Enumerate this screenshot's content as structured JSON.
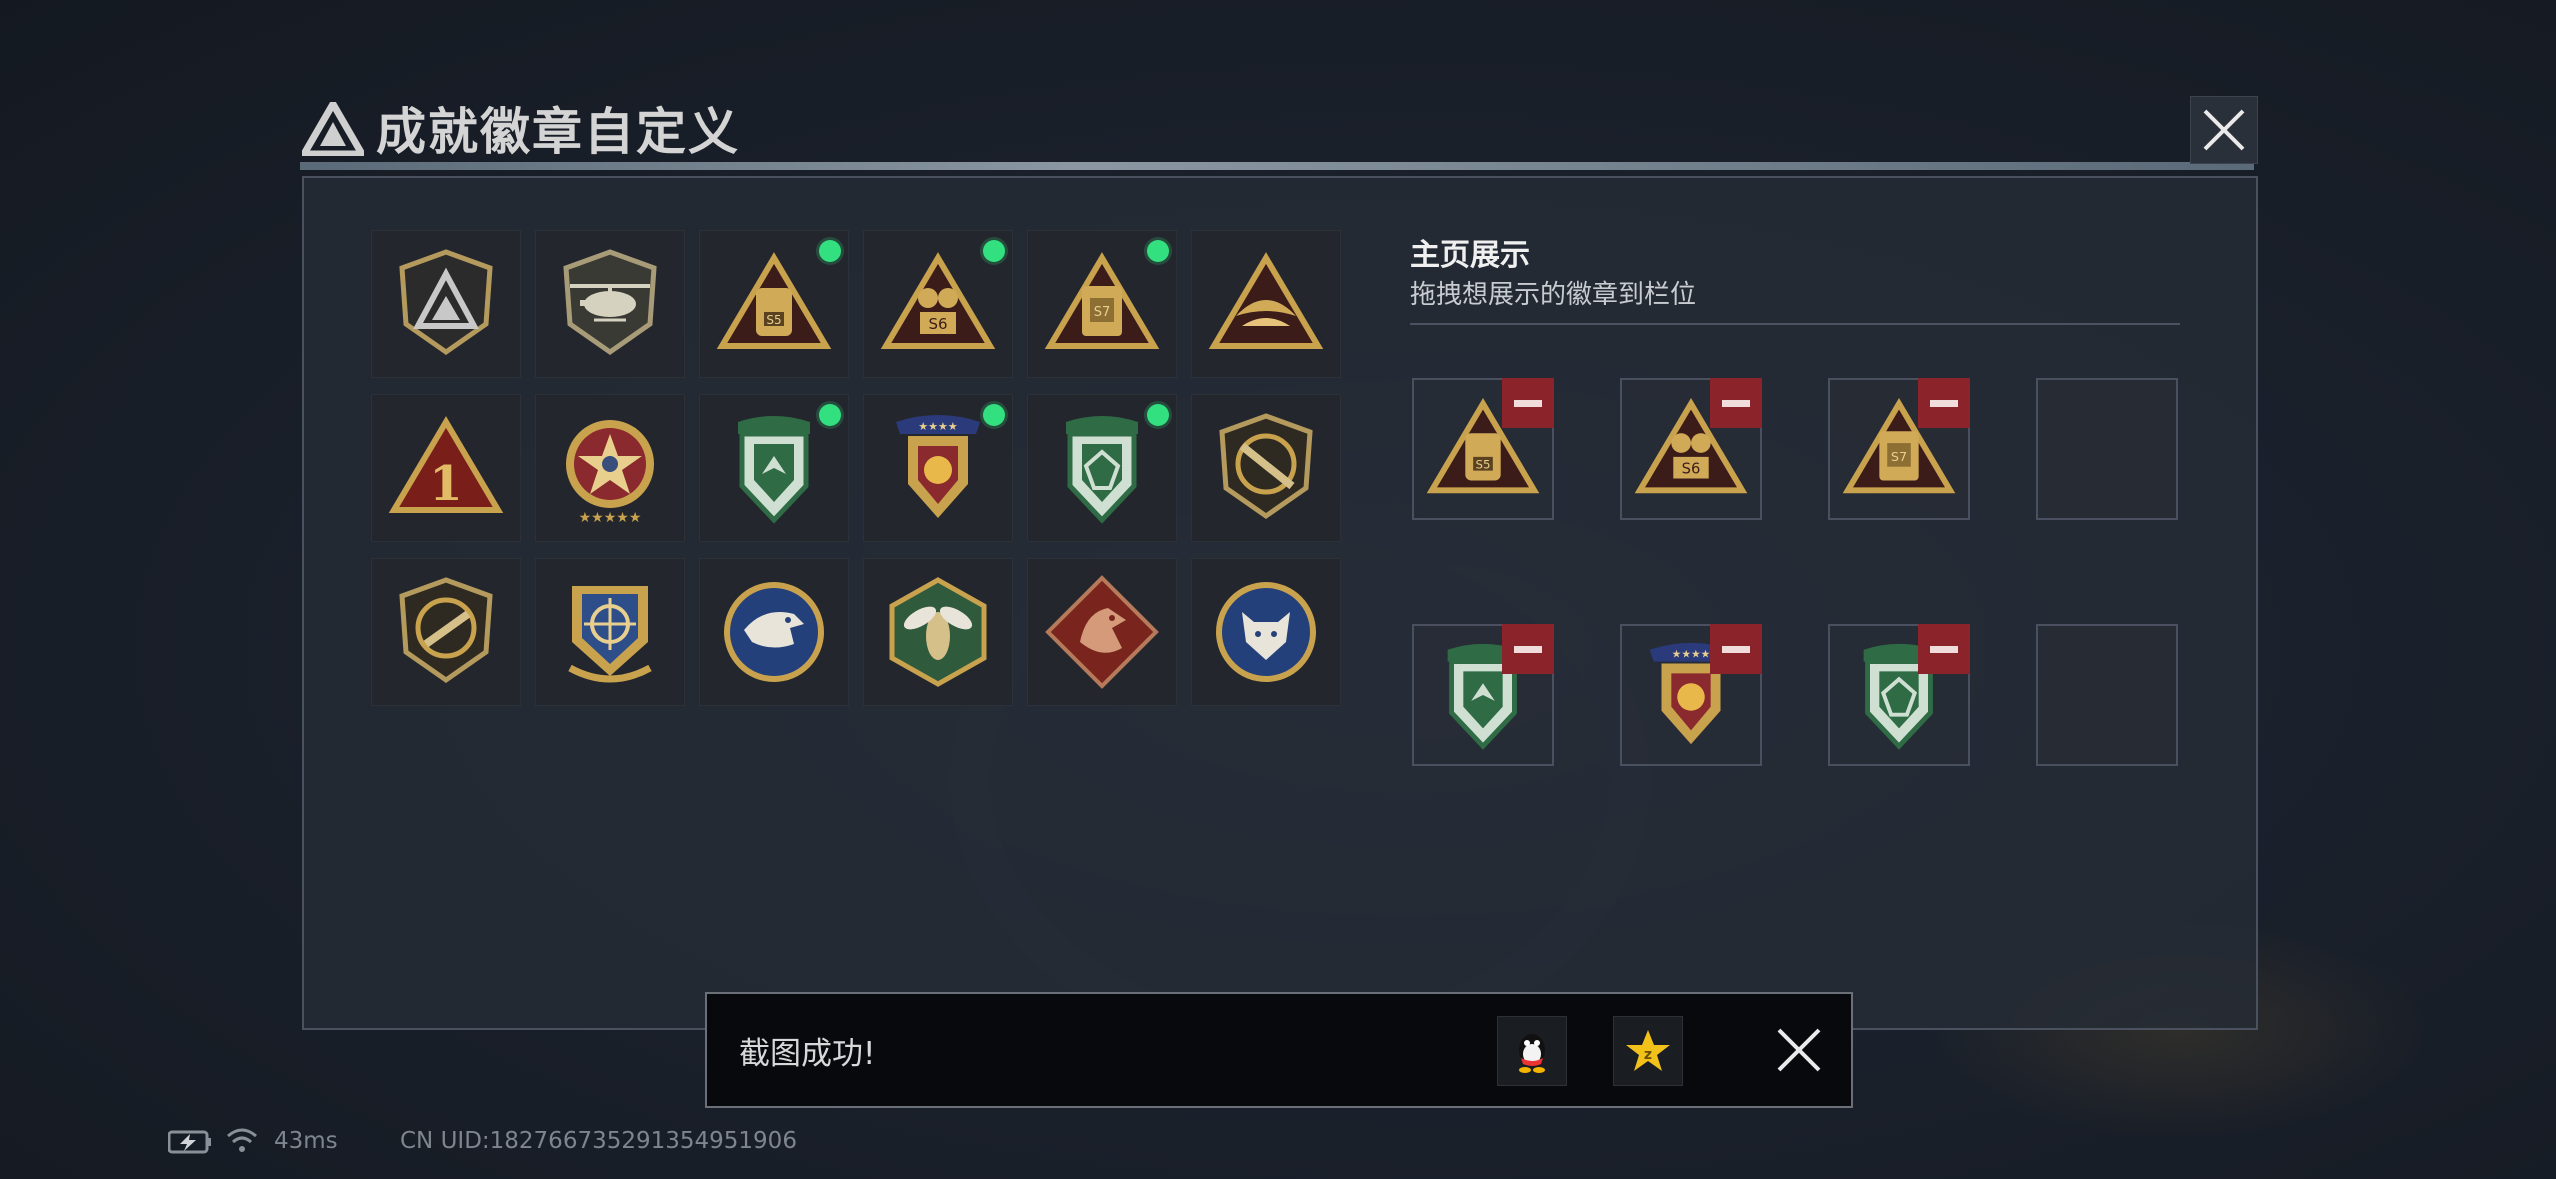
{
  "header": {
    "title": "成就徽章自定义",
    "close_icon": "close-icon"
  },
  "badges": [
    {
      "name": "squad-logo-badge",
      "new": false
    },
    {
      "name": "helicopter-badge",
      "new": false
    },
    {
      "name": "s5-season-badge",
      "new": true
    },
    {
      "name": "s6-season-badge",
      "new": true
    },
    {
      "name": "s7-season-badge",
      "new": true
    },
    {
      "name": "golden-wings-badge",
      "new": false
    },
    {
      "name": "rank-one-badge",
      "new": false
    },
    {
      "name": "star-medal-badge",
      "new": false
    },
    {
      "name": "green-shield-arrow-badge",
      "new": true
    },
    {
      "name": "gold-shield-stars-badge",
      "new": true
    },
    {
      "name": "green-shield-gem-badge",
      "new": true
    },
    {
      "name": "rifle-shield-badge",
      "new": false
    },
    {
      "name": "smg-shield-badge",
      "new": false
    },
    {
      "name": "crosshair-shield-badge",
      "new": false
    },
    {
      "name": "eagle-badge",
      "new": false
    },
    {
      "name": "wasp-badge",
      "new": false
    },
    {
      "name": "dragon-badge",
      "new": false
    },
    {
      "name": "wolf-badge",
      "new": false
    }
  ],
  "showcase": {
    "title": "主页展示",
    "subtitle": "拖拽想展示的徽章到栏位",
    "slots": [
      {
        "badge": "s5-season-badge"
      },
      {
        "badge": "s6-season-badge"
      },
      {
        "badge": "s7-season-badge"
      },
      {
        "badge": ""
      },
      {
        "badge": "green-shield-arrow-badge"
      },
      {
        "badge": "gold-shield-stars-badge"
      },
      {
        "badge": "green-shield-gem-badge"
      },
      {
        "badge": ""
      }
    ]
  },
  "toast": {
    "message": "截图成功!",
    "share_buttons": [
      "qq-icon",
      "qzone-star-icon"
    ]
  },
  "status_bar": {
    "ping": "43ms",
    "uid": "CN UID:182766735291354951906"
  },
  "colors": {
    "new_dot": "#33e07f",
    "remove_button": "#8b232a",
    "gold": "#c9a24e",
    "green_badge": "#2f6b45"
  }
}
